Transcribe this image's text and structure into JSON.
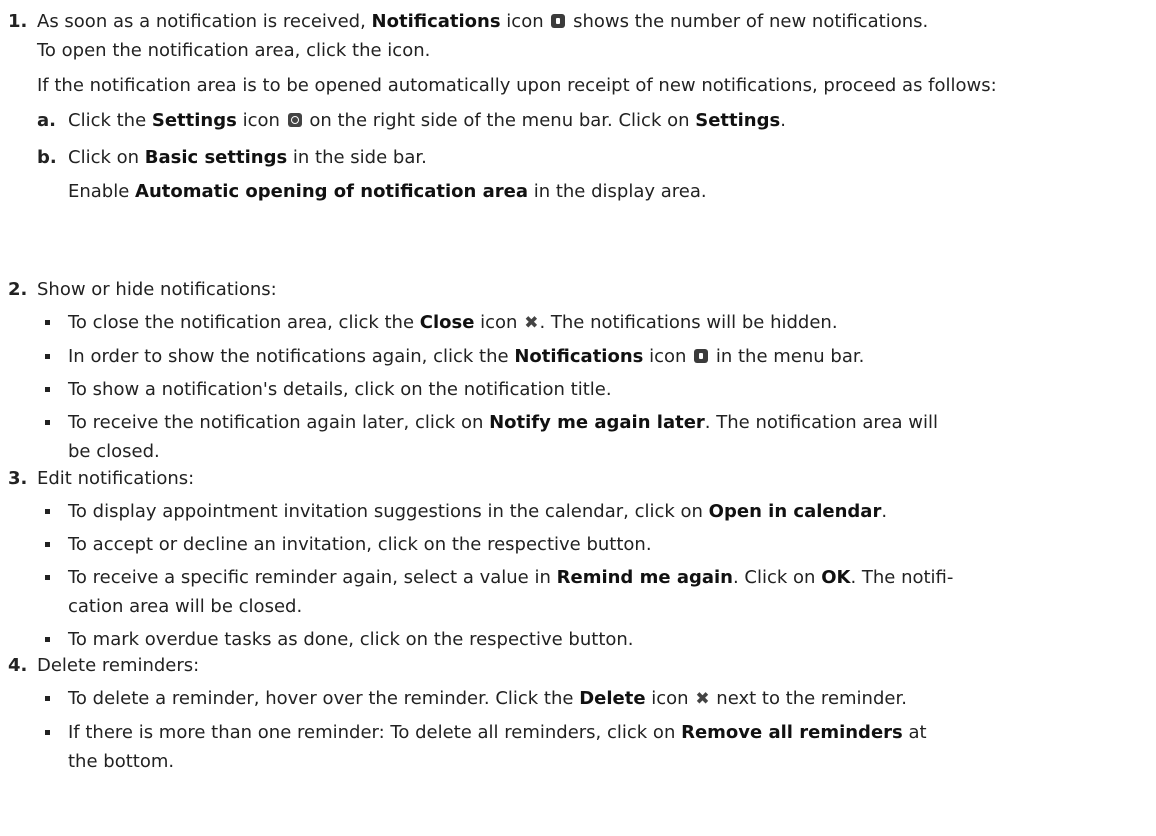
{
  "steps": [
    {
      "num": "1.",
      "p1": [
        "As soon as a notification is received, ",
        "Notifications",
        " icon ",
        " shows the number of new notifications.",
        "To open the notification area, click the icon."
      ],
      "p2": "If the notification area is to be opened automatically upon receipt of new notifications, proceed as follows:",
      "a": {
        "letter": "a.",
        "t": [
          "Click the ",
          "Settings",
          " icon ",
          " on the right side of the menu bar. Click on ",
          "Settings",
          "."
        ]
      },
      "b": {
        "letter": "b.",
        "t": [
          "Click on ",
          "Basic settings",
          " in the side bar."
        ],
        "t2": [
          "Enable ",
          "Automatic opening of notification area",
          " in the display area."
        ]
      }
    },
    {
      "num": "2.",
      "intro": "Show or hide notifications:",
      "bullets": [
        [
          "To close the notification area, click the ",
          "Close",
          " icon ",
          ". The notifications will be hidden."
        ],
        [
          "In order to show the notifications again, click the ",
          "Notifications",
          " icon ",
          " in the menu bar."
        ],
        [
          "To show a notification's details, click on the notification title."
        ],
        [
          "To receive the notification again later, click on ",
          "Notify me again later",
          ". The notification area will",
          "be closed."
        ]
      ]
    },
    {
      "num": "3.",
      "intro": "Edit notifications:",
      "bullets": [
        [
          "To display appointment invitation suggestions in the calendar, click on ",
          "Open in calendar",
          "."
        ],
        [
          "To accept or decline an invitation, click on the respective button."
        ],
        [
          "To receive a specific reminder again, select a value in ",
          "Remind me again",
          ". Click on ",
          "OK",
          ". The notifi-",
          "cation area will be closed."
        ],
        [
          "To mark overdue tasks as done, click on the respective button."
        ]
      ]
    },
    {
      "num": "4.",
      "intro": "Delete reminders:",
      "bullets": [
        [
          "To delete a reminder, hover over the reminder. Click the ",
          "Delete",
          " icon ",
          " next to the reminder."
        ],
        [
          "If there is more than one reminder: To delete all reminders, click on ",
          "Remove all reminders",
          " at",
          "the bottom."
        ]
      ]
    }
  ],
  "icons": {
    "notifications": "notification-badge-icon",
    "settings": "gear-icon",
    "close": "close-x-icon",
    "delete": "delete-x-icon"
  }
}
